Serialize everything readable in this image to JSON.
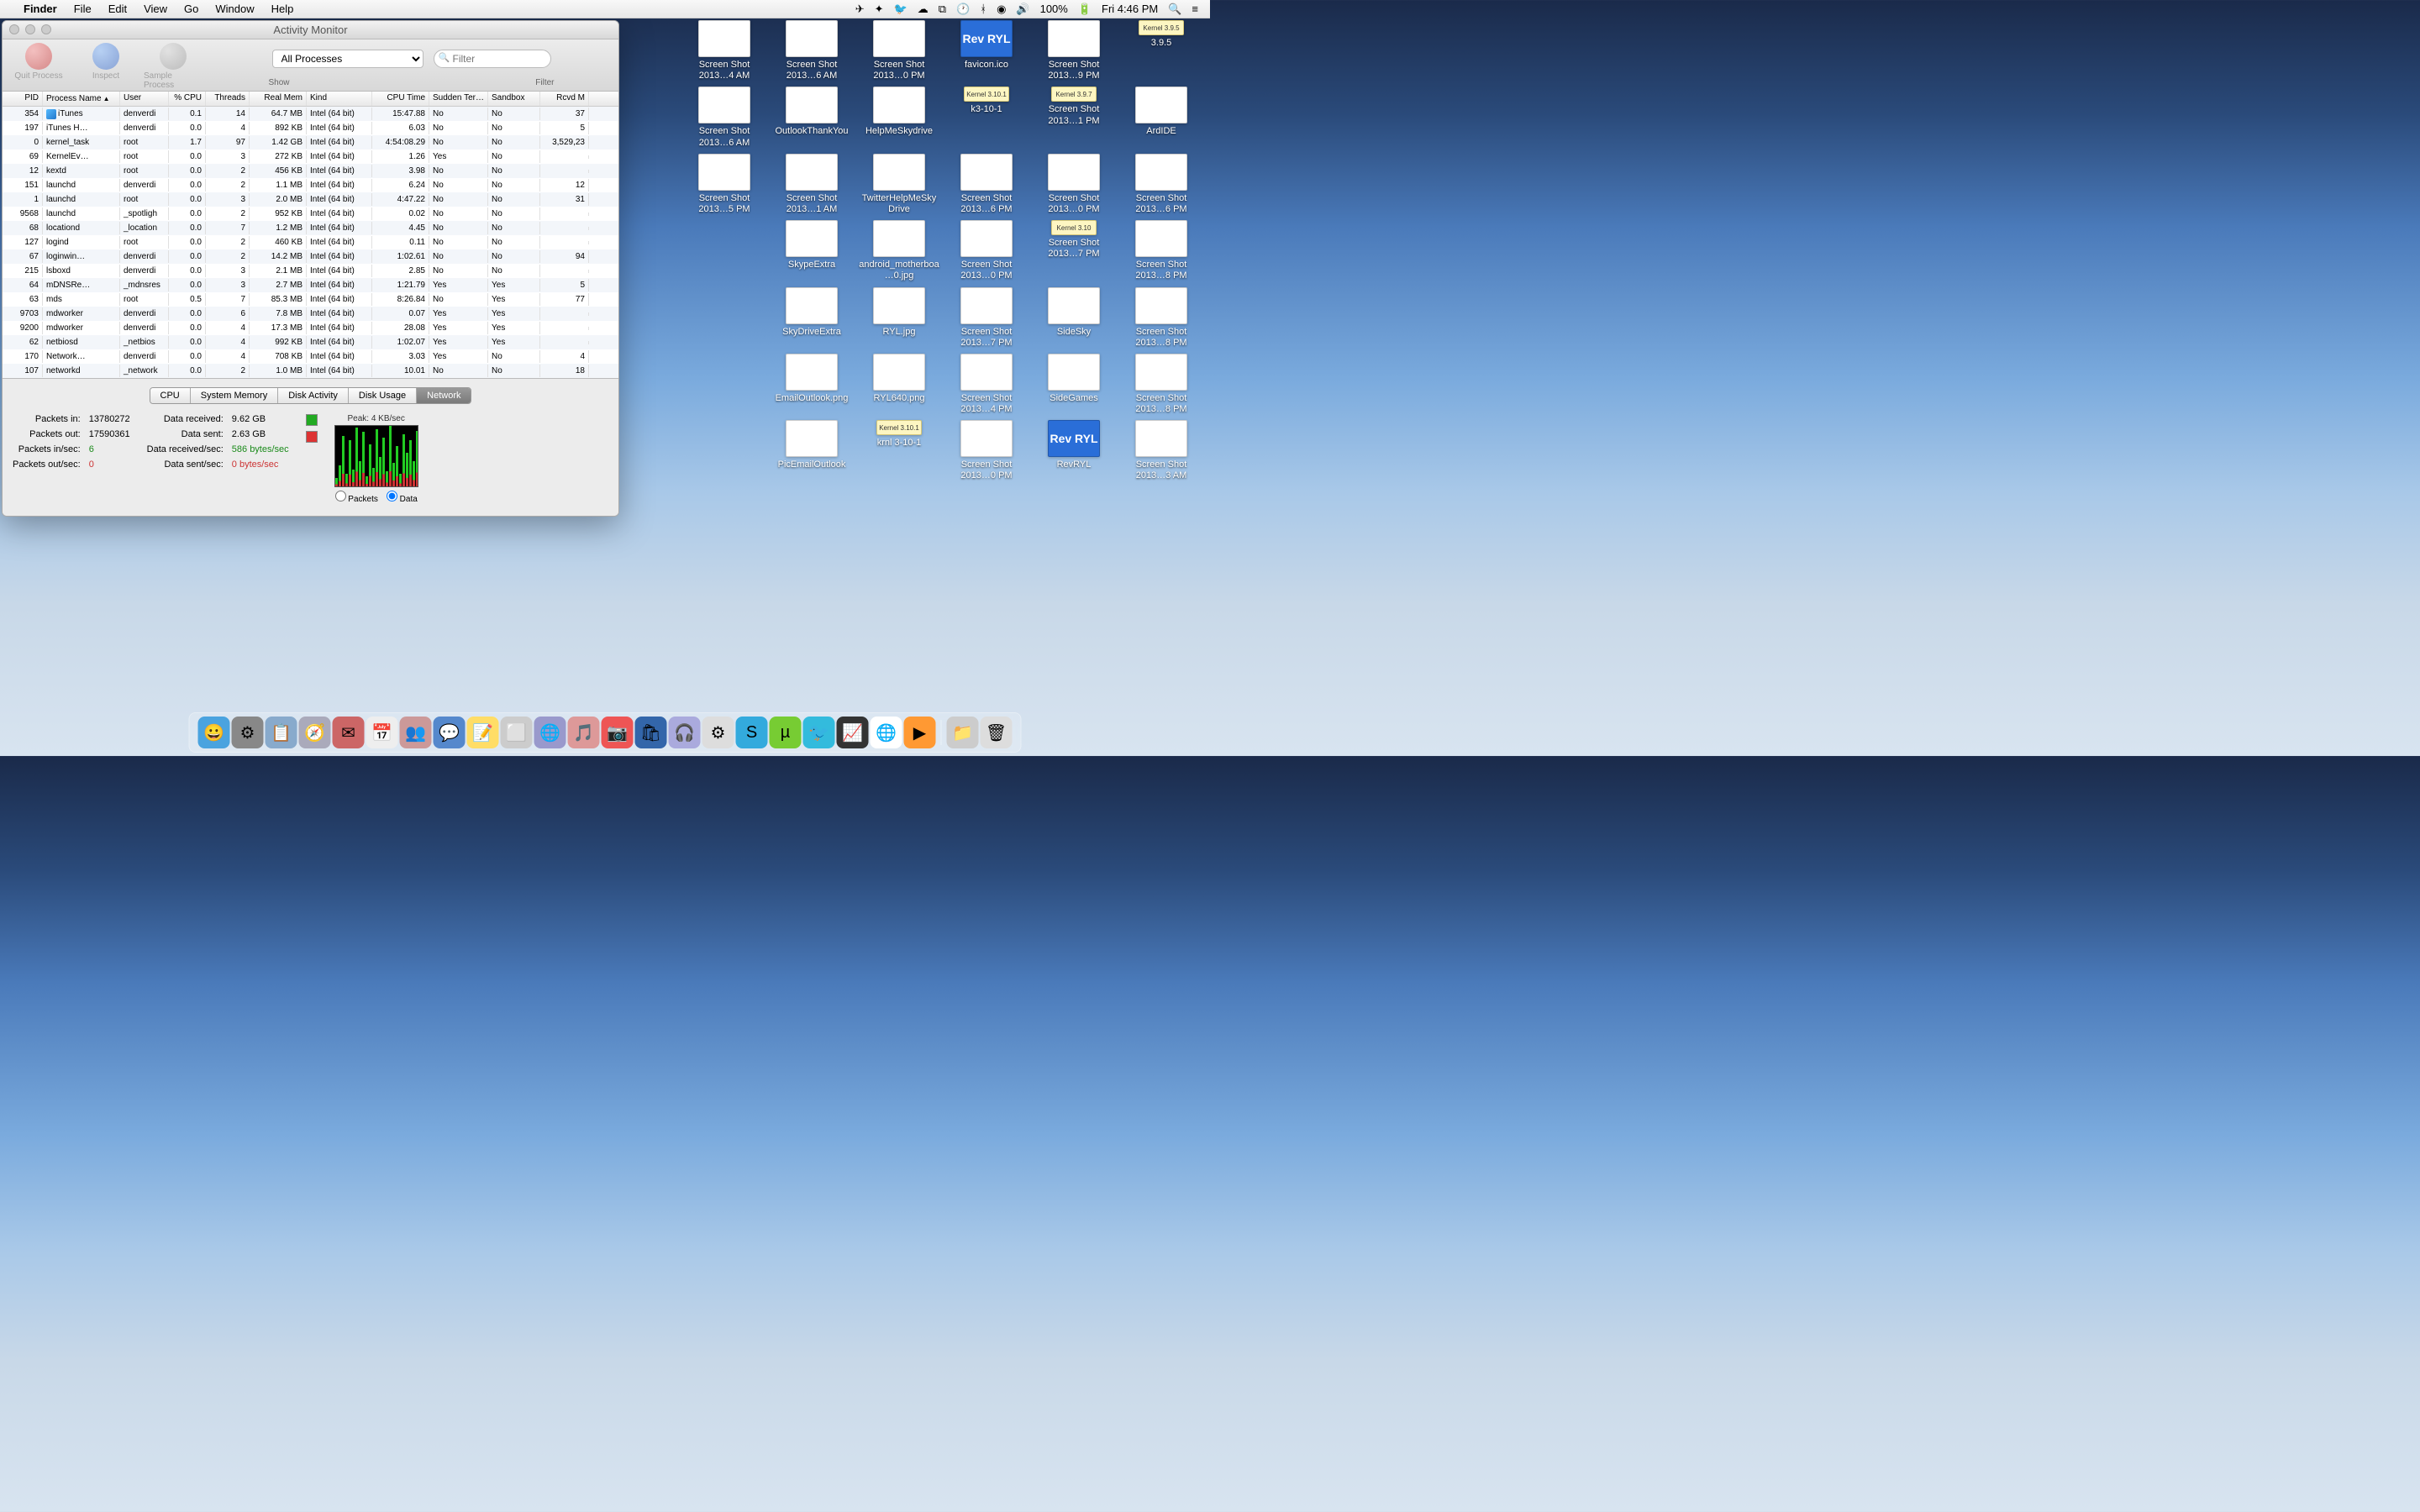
{
  "menubar": {
    "app": "Finder",
    "items": [
      "File",
      "Edit",
      "View",
      "Go",
      "Window",
      "Help"
    ],
    "battery": "100%",
    "clock": "Fri 4:46 PM"
  },
  "window": {
    "title": "Activity Monitor",
    "toolbar": {
      "quit": "Quit Process",
      "inspect": "Inspect",
      "sample": "Sample Process",
      "filter_select": "All Processes",
      "filter_placeholder": "Filter",
      "show_label": "Show",
      "filter_label": "Filter"
    },
    "columns": [
      "PID",
      "Process Name",
      "User",
      "% CPU",
      "Threads",
      "Real Mem",
      "Kind",
      "CPU Time",
      "Sudden Term.",
      "Sandbox",
      "Rcvd M"
    ],
    "rows": [
      {
        "pid": "354",
        "name": "iTunes",
        "user": "denverdi",
        "cpu": "0.1",
        "thr": "14",
        "mem": "64.7 MB",
        "kind": "Intel (64 bit)",
        "time": "15:47.88",
        "sud": "No",
        "sand": "No",
        "rcvd": "37",
        "icon": true
      },
      {
        "pid": "197",
        "name": "iTunes H…",
        "user": "denverdi",
        "cpu": "0.0",
        "thr": "4",
        "mem": "892 KB",
        "kind": "Intel (64 bit)",
        "time": "6.03",
        "sud": "No",
        "sand": "No",
        "rcvd": "5"
      },
      {
        "pid": "0",
        "name": "kernel_task",
        "user": "root",
        "cpu": "1.7",
        "thr": "97",
        "mem": "1.42 GB",
        "kind": "Intel (64 bit)",
        "time": "4:54:08.29",
        "sud": "No",
        "sand": "No",
        "rcvd": "3,529,23"
      },
      {
        "pid": "69",
        "name": "KernelEv…",
        "user": "root",
        "cpu": "0.0",
        "thr": "3",
        "mem": "272 KB",
        "kind": "Intel (64 bit)",
        "time": "1.26",
        "sud": "Yes",
        "sand": "No",
        "rcvd": ""
      },
      {
        "pid": "12",
        "name": "kextd",
        "user": "root",
        "cpu": "0.0",
        "thr": "2",
        "mem": "456 KB",
        "kind": "Intel (64 bit)",
        "time": "3.98",
        "sud": "No",
        "sand": "No",
        "rcvd": ""
      },
      {
        "pid": "151",
        "name": "launchd",
        "user": "denverdi",
        "cpu": "0.0",
        "thr": "2",
        "mem": "1.1 MB",
        "kind": "Intel (64 bit)",
        "time": "6.24",
        "sud": "No",
        "sand": "No",
        "rcvd": "12"
      },
      {
        "pid": "1",
        "name": "launchd",
        "user": "root",
        "cpu": "0.0",
        "thr": "3",
        "mem": "2.0 MB",
        "kind": "Intel (64 bit)",
        "time": "4:47.22",
        "sud": "No",
        "sand": "No",
        "rcvd": "31"
      },
      {
        "pid": "9568",
        "name": "launchd",
        "user": "_spotligh",
        "cpu": "0.0",
        "thr": "2",
        "mem": "952 KB",
        "kind": "Intel (64 bit)",
        "time": "0.02",
        "sud": "No",
        "sand": "No",
        "rcvd": ""
      },
      {
        "pid": "68",
        "name": "locationd",
        "user": "_location",
        "cpu": "0.0",
        "thr": "7",
        "mem": "1.2 MB",
        "kind": "Intel (64 bit)",
        "time": "4.45",
        "sud": "No",
        "sand": "No",
        "rcvd": ""
      },
      {
        "pid": "127",
        "name": "logind",
        "user": "root",
        "cpu": "0.0",
        "thr": "2",
        "mem": "460 KB",
        "kind": "Intel (64 bit)",
        "time": "0.11",
        "sud": "No",
        "sand": "No",
        "rcvd": ""
      },
      {
        "pid": "67",
        "name": "loginwin…",
        "user": "denverdi",
        "cpu": "0.0",
        "thr": "2",
        "mem": "14.2 MB",
        "kind": "Intel (64 bit)",
        "time": "1:02.61",
        "sud": "No",
        "sand": "No",
        "rcvd": "94"
      },
      {
        "pid": "215",
        "name": "lsboxd",
        "user": "denverdi",
        "cpu": "0.0",
        "thr": "3",
        "mem": "2.1 MB",
        "kind": "Intel (64 bit)",
        "time": "2.85",
        "sud": "No",
        "sand": "No",
        "rcvd": ""
      },
      {
        "pid": "64",
        "name": "mDNSRe…",
        "user": "_mdnsres",
        "cpu": "0.0",
        "thr": "3",
        "mem": "2.7 MB",
        "kind": "Intel (64 bit)",
        "time": "1:21.79",
        "sud": "Yes",
        "sand": "Yes",
        "rcvd": "5"
      },
      {
        "pid": "63",
        "name": "mds",
        "user": "root",
        "cpu": "0.5",
        "thr": "7",
        "mem": "85.3 MB",
        "kind": "Intel (64 bit)",
        "time": "8:26.84",
        "sud": "No",
        "sand": "Yes",
        "rcvd": "77"
      },
      {
        "pid": "9703",
        "name": "mdworker",
        "user": "denverdi",
        "cpu": "0.0",
        "thr": "6",
        "mem": "7.8 MB",
        "kind": "Intel (64 bit)",
        "time": "0.07",
        "sud": "Yes",
        "sand": "Yes",
        "rcvd": ""
      },
      {
        "pid": "9200",
        "name": "mdworker",
        "user": "denverdi",
        "cpu": "0.0",
        "thr": "4",
        "mem": "17.3 MB",
        "kind": "Intel (64 bit)",
        "time": "28.08",
        "sud": "Yes",
        "sand": "Yes",
        "rcvd": ""
      },
      {
        "pid": "62",
        "name": "netbiosd",
        "user": "_netbios",
        "cpu": "0.0",
        "thr": "4",
        "mem": "992 KB",
        "kind": "Intel (64 bit)",
        "time": "1:02.07",
        "sud": "Yes",
        "sand": "Yes",
        "rcvd": ""
      },
      {
        "pid": "170",
        "name": "Network…",
        "user": "denverdi",
        "cpu": "0.0",
        "thr": "4",
        "mem": "708 KB",
        "kind": "Intel (64 bit)",
        "time": "3.03",
        "sud": "Yes",
        "sand": "No",
        "rcvd": "4"
      },
      {
        "pid": "107",
        "name": "networkd",
        "user": "_network",
        "cpu": "0.0",
        "thr": "2",
        "mem": "1.0 MB",
        "kind": "Intel (64 bit)",
        "time": "10.01",
        "sud": "No",
        "sand": "No",
        "rcvd": "18"
      }
    ],
    "tabs": [
      "CPU",
      "System Memory",
      "Disk Activity",
      "Disk Usage",
      "Network"
    ],
    "active_tab": 4,
    "network": {
      "packets_in_k": "Packets in:",
      "packets_in_v": "13780272",
      "packets_out_k": "Packets out:",
      "packets_out_v": "17590361",
      "packets_in_sec_k": "Packets in/sec:",
      "packets_in_sec_v": "6",
      "packets_out_sec_k": "Packets out/sec:",
      "packets_out_sec_v": "0",
      "data_recv_k": "Data received:",
      "data_recv_v": "9.62 GB",
      "data_sent_k": "Data sent:",
      "data_sent_v": "2.63 GB",
      "data_recv_sec_k": "Data received/sec:",
      "data_recv_sec_v": "586 bytes/sec",
      "data_sent_sec_k": "Data sent/sec:",
      "data_sent_sec_v": "0 bytes/sec",
      "peak": "Peak: 4 KB/sec",
      "radio_packets": "Packets",
      "radio_data": "Data"
    }
  },
  "desktop_icons": [
    [
      {
        "l": "Screen Shot 2013…4 AM",
        "t": "img"
      },
      {
        "l": "Screen Shot 2013…6 AM",
        "t": "img"
      },
      {
        "l": "Screen Shot 2013…0 PM",
        "t": "img"
      },
      {
        "l": "favicon.ico",
        "t": "blue",
        "txt": "Rev RYL"
      },
      {
        "l": "Screen Shot 2013…9 PM",
        "t": "img"
      },
      {
        "l": "3.9.5",
        "t": "note",
        "txt": "Kernel 3.9.5"
      }
    ],
    [
      {
        "l": "Screen Shot 2013…6 AM",
        "t": "img"
      },
      {
        "l": "OutlookThankYou",
        "t": "img"
      },
      {
        "l": "HelpMeSkydrive",
        "t": "img"
      },
      {
        "l": "k3-10-1",
        "t": "note",
        "txt": "Kernel 3.10.1"
      },
      {
        "l": "Screen Shot 2013…1 PM",
        "t": "note",
        "txt": "Kernel 3.9.7"
      },
      {
        "l": "ArdIDE",
        "t": "img"
      }
    ],
    [
      {
        "l": "Screen Shot 2013…5 PM",
        "t": "img"
      },
      {
        "l": "Screen Shot 2013…1 AM",
        "t": "img"
      },
      {
        "l": "TwitterHelpMeSkyDrive",
        "t": "img"
      },
      {
        "l": "Screen Shot 2013…6 PM",
        "t": "img"
      },
      {
        "l": "Screen Shot 2013…0 PM",
        "t": "img"
      },
      {
        "l": "Screen Shot 2013…6 PM",
        "t": "img"
      }
    ],
    [
      {
        "l": "",
        "t": "none"
      },
      {
        "l": "SkypeExtra",
        "t": "img"
      },
      {
        "l": "android_motherboa…0.jpg",
        "t": "img"
      },
      {
        "l": "Screen Shot 2013…0 PM",
        "t": "img"
      },
      {
        "l": "Screen Shot 2013…7 PM",
        "t": "note",
        "txt": "Kernel 3.10"
      },
      {
        "l": "Screen Shot 2013…8 PM",
        "t": "img"
      }
    ],
    [
      {
        "l": "",
        "t": "none"
      },
      {
        "l": "SkyDriveExtra",
        "t": "img"
      },
      {
        "l": "RYL.jpg",
        "t": "img"
      },
      {
        "l": "Screen Shot 2013…7 PM",
        "t": "img"
      },
      {
        "l": "SideSky",
        "t": "img"
      },
      {
        "l": "Screen Shot 2013…8 PM",
        "t": "img"
      }
    ],
    [
      {
        "l": "",
        "t": "none"
      },
      {
        "l": "EmailOutlook.png",
        "t": "img"
      },
      {
        "l": "RYL640.png",
        "t": "img"
      },
      {
        "l": "Screen Shot 2013…4 PM",
        "t": "img"
      },
      {
        "l": "SideGames",
        "t": "img"
      },
      {
        "l": "Screen Shot 2013…8 PM",
        "t": "img"
      }
    ],
    [
      {
        "l": "",
        "t": "none"
      },
      {
        "l": "PicEmailOutlook",
        "t": "img"
      },
      {
        "l": "krnl 3-10-1",
        "t": "note",
        "txt": "Kernel 3.10.1"
      },
      {
        "l": "Screen Shot 2013…0 PM",
        "t": "img"
      },
      {
        "l": "RevRYL",
        "t": "blue",
        "txt": "Rev RYL"
      },
      {
        "l": "Screen Shot 2013…3 AM",
        "t": "img"
      }
    ]
  ],
  "dock_apps": [
    {
      "c": "#4aa3df",
      "g": "😀"
    },
    {
      "c": "#888",
      "g": "⚙"
    },
    {
      "c": "#8ac",
      "g": "📋"
    },
    {
      "c": "#aab",
      "g": "🧭"
    },
    {
      "c": "#c66",
      "g": "✉"
    },
    {
      "c": "#eee",
      "g": "📅"
    },
    {
      "c": "#c99",
      "g": "👥"
    },
    {
      "c": "#58c",
      "g": "💬"
    },
    {
      "c": "#fd6",
      "g": "📝"
    },
    {
      "c": "#ccc",
      "g": "⬜"
    },
    {
      "c": "#99c",
      "g": "🌐"
    },
    {
      "c": "#d99",
      "g": "🎵"
    },
    {
      "c": "#e55",
      "g": "📷"
    },
    {
      "c": "#36a",
      "g": "🛍"
    },
    {
      "c": "#aad",
      "g": "🎧"
    },
    {
      "c": "#ddd",
      "g": "⚙"
    },
    {
      "c": "#3ad",
      "g": "S"
    },
    {
      "c": "#7c3",
      "g": "µ"
    },
    {
      "c": "#3bd",
      "g": "🐦"
    },
    {
      "c": "#333",
      "g": "📈"
    },
    {
      "c": "#fff",
      "g": "🌐"
    },
    {
      "c": "#f93",
      "g": "▶"
    }
  ],
  "dock_right": [
    {
      "c": "#ccc",
      "g": "📁"
    },
    {
      "c": "#ddd",
      "g": "🗑"
    }
  ]
}
